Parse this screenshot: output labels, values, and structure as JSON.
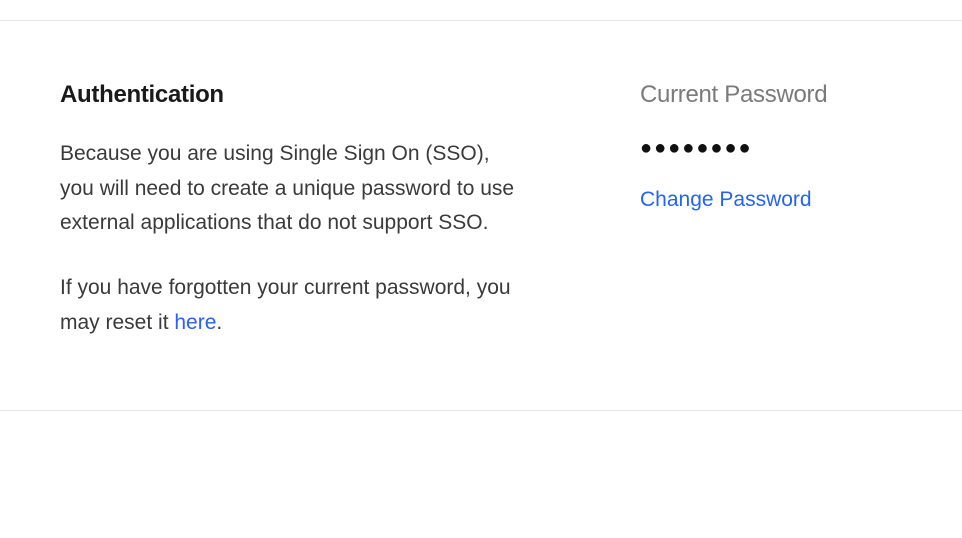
{
  "authentication": {
    "title": "Authentication",
    "description": "Because you are using Single Sign On (SSO), you will need to create a unique password to use external applications that do not support SSO.",
    "reset_prefix": "If you have forgotten your current password, you may reset it ",
    "reset_link_text": "here",
    "reset_suffix": "."
  },
  "password": {
    "label": "Current Password",
    "masked_value": "●●●●●●●●",
    "change_link_text": "Change Password"
  }
}
